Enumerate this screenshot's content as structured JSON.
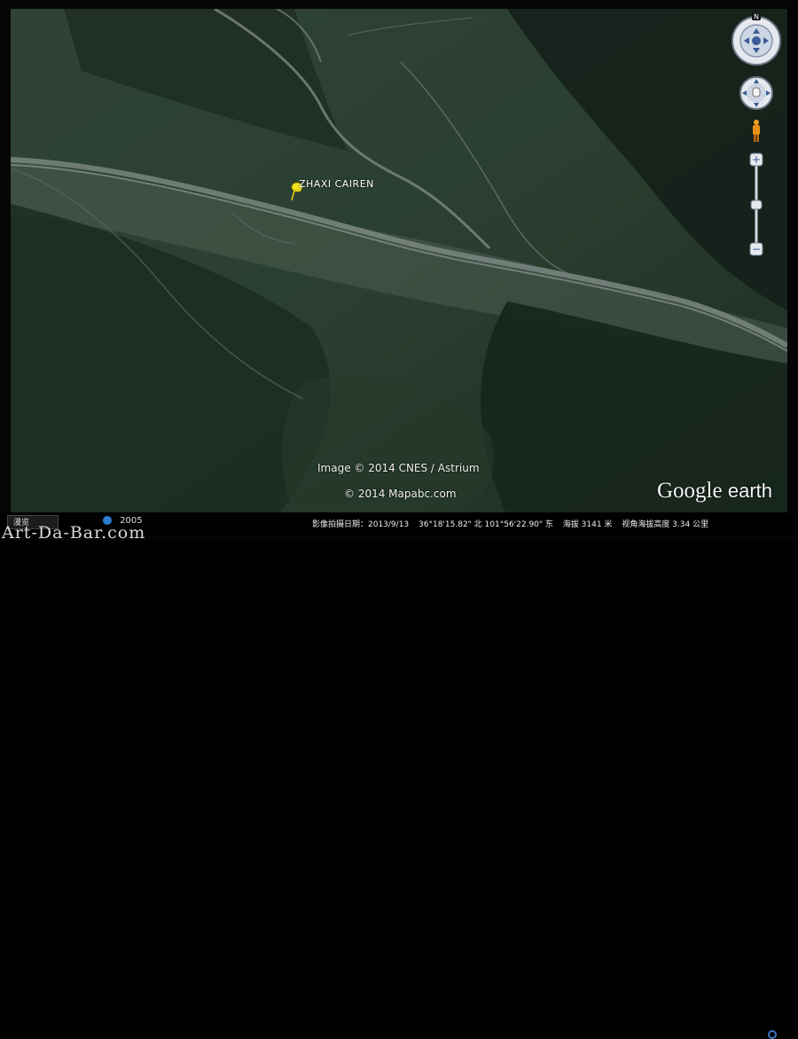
{
  "placemark": {
    "label": "ZHAXI  CAIREN"
  },
  "credits": {
    "imagery": "Image © 2014 CNES / Astrium",
    "map": "© 2014 Mapabc.com"
  },
  "logo": {
    "google": "Google",
    "earth": "earth"
  },
  "statusbar": {
    "tour_label": "漫览",
    "history_year": "2005",
    "imagery_date": "影像拍摄日期：2013/9/13",
    "coordinates": "36°18'15.82\" 北  101°56'22.90\" 东",
    "elevation": "海拔  3141 米",
    "eye_altitude": "视角海拔高度   3.34 公里"
  },
  "watermark": "Art-Da-Bar.com",
  "controls": {
    "compass_north": "N",
    "zoom_in": "+",
    "zoom_out": "−"
  },
  "colors": {
    "terrain_dark": "#1f3127",
    "terrain_mid": "#33483a",
    "river": "#7f8a86",
    "pin": "#f2e21b"
  }
}
